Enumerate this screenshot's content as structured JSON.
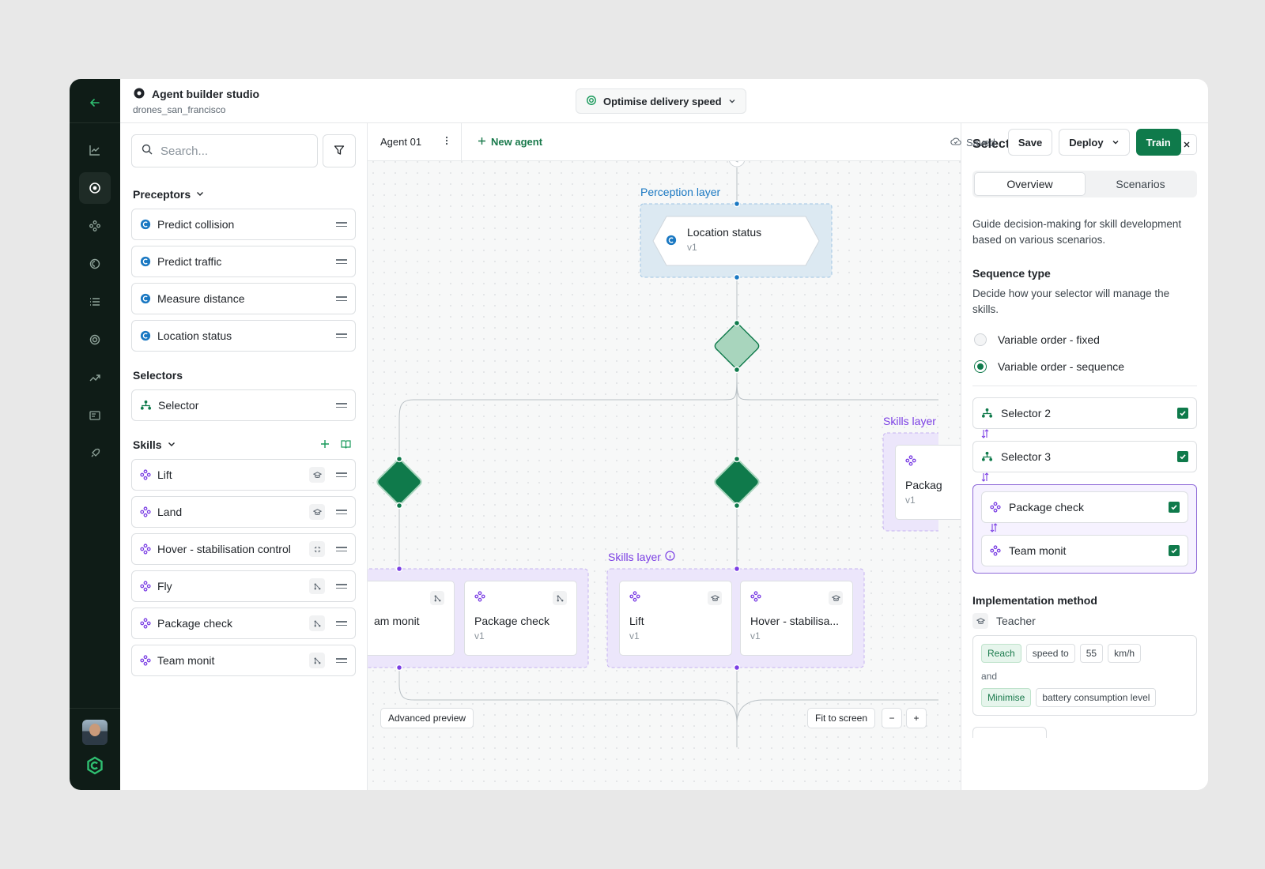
{
  "header": {
    "title": "Agent builder studio",
    "subtitle": "drones_san_francisco",
    "goal": "Optimise delivery speed"
  },
  "left": {
    "search_placeholder": "Search...",
    "preceptors_title": "Preceptors",
    "preceptors": [
      "Predict collision",
      "Predict traffic",
      "Measure distance",
      "Location status"
    ],
    "selectors_title": "Selectors",
    "selectors": [
      "Selector"
    ],
    "skills_title": "Skills",
    "skills": [
      {
        "label": "Lift",
        "badge": "teacher"
      },
      {
        "label": "Land",
        "badge": "teacher"
      },
      {
        "label": "Hover - stabilisation control",
        "badge": "expand"
      },
      {
        "label": "Fly",
        "badge": "network"
      },
      {
        "label": "Package check",
        "badge": "network"
      },
      {
        "label": "Team monit",
        "badge": "network"
      }
    ]
  },
  "toolbar": {
    "agent_tab": "Agent 01",
    "new_agent": "New agent",
    "saved": "Saved",
    "save": "Save",
    "deploy": "Deploy",
    "train": "Train"
  },
  "canvas": {
    "perception_label": "Perception layer",
    "perception_node": {
      "title": "Location status",
      "version": "v1"
    },
    "skills_label_main": "Skills layer",
    "skills_label_right": "Skills layer",
    "left_group": [
      {
        "title": "am monit",
        "version": ""
      },
      {
        "title": "Package check",
        "version": "v1"
      }
    ],
    "main_group": [
      {
        "title": "Lift",
        "version": "v1"
      },
      {
        "title": "Hover - stabilisa...",
        "version": "v1"
      }
    ],
    "right_group": [
      {
        "title": "Packag",
        "version": "v1"
      }
    ],
    "advanced_preview": "Advanced preview",
    "fit_to_screen": "Fit to screen",
    "zoom_out": "−",
    "zoom_in": "+"
  },
  "right": {
    "title": "Selector",
    "tabs": [
      "Overview",
      "Scenarios"
    ],
    "description": "Guide decision-making for skill development based on various scenarios.",
    "sequence_title": "Sequence type",
    "sequence_desc": "Decide how your selector will manage the skills.",
    "radio_options": [
      "Variable order - fixed",
      "Variable order - sequence"
    ],
    "selected_radio": "Variable order - sequence",
    "sequence_items": [
      "Selector 2",
      "Selector 3"
    ],
    "group_items": [
      "Package check",
      "Team monit"
    ],
    "impl_title": "Implementation method",
    "impl_value": "Teacher",
    "chips_row1": [
      "Reach",
      "speed to",
      "55",
      "km/h"
    ],
    "chips_and": "and",
    "chips_row2": [
      "Minimise",
      "battery consumption level"
    ]
  },
  "colors": {
    "brand_green": "#0f7a4b",
    "perception_blue": "#1a78c2",
    "skill_purple": "#7b3fe4"
  }
}
